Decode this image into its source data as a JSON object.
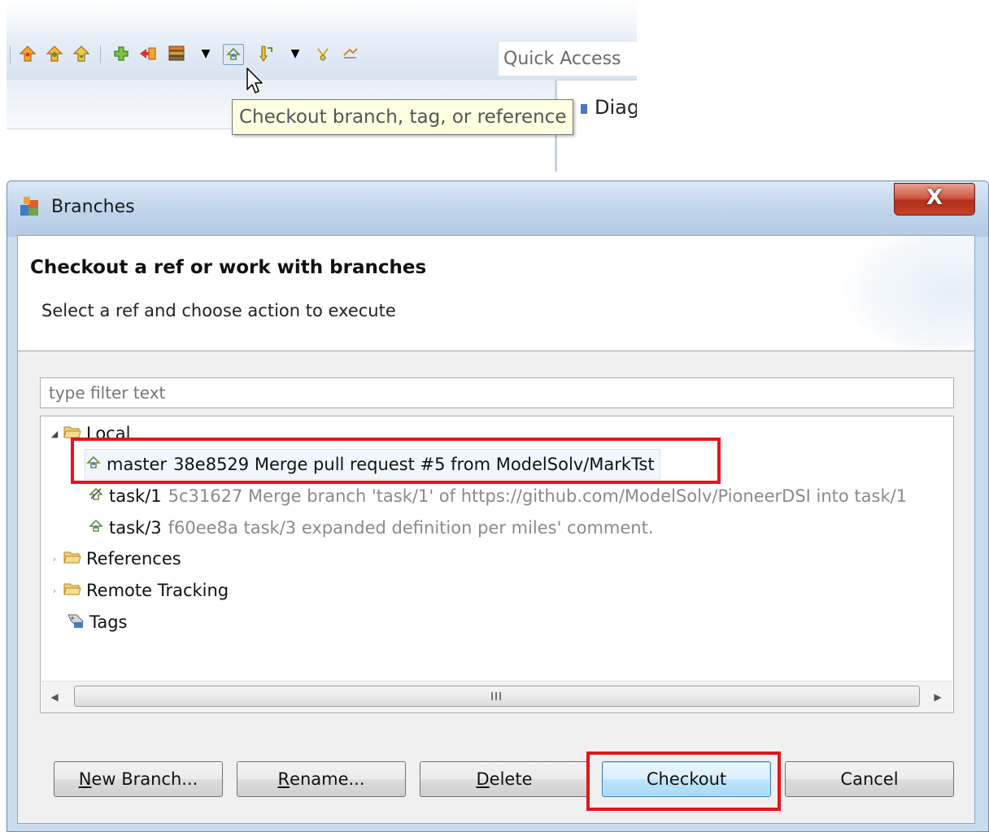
{
  "toolbar": {
    "quick_access": "Quick Access",
    "tooltip": "Checkout branch, tag, or reference",
    "partial_tab": "Diag"
  },
  "dialog": {
    "title": "Branches",
    "close_glyph": "X",
    "header_title": "Checkout a ref or work with branches",
    "header_message": "Select a ref and choose action to execute",
    "filter_placeholder": "type filter text",
    "tree": {
      "local": {
        "label": "Local",
        "branches": [
          {
            "name": "master",
            "detail": "38e8529 Merge pull request #5 from ModelSolv/MarkTst"
          },
          {
            "name": "task/1",
            "detail": "5c31627 Merge branch 'task/1' of https://github.com/ModelSolv/PioneerDSI into task/1"
          },
          {
            "name": "task/3",
            "detail": "f60ee8a task/3 expanded definition per miles' comment."
          }
        ]
      },
      "references": "References",
      "remote_tracking": "Remote Tracking",
      "tags": "Tags"
    },
    "buttons": {
      "new_branch": {
        "mnemonic": "N",
        "rest": "ew Branch..."
      },
      "rename": {
        "mnemonic": "R",
        "rest": "ename..."
      },
      "delete": {
        "mnemonic": "D",
        "rest": "elete"
      },
      "checkout": "Checkout",
      "cancel": "Cancel"
    }
  },
  "colors": {
    "highlight_box": "#e5141b",
    "selection_bg": "#f0f7fe",
    "tooltip_bg": "#ffffe1",
    "title_bar": "#bfd4ea",
    "close_button": "#c7422b"
  },
  "icons": [
    "push-up-icon",
    "fetch-icon",
    "pull-icon",
    "add-icon",
    "merge-icon",
    "stash-icon",
    "dropdown-icon",
    "checkout-branch-icon",
    "commit-icon",
    "history-icon",
    "sync-icon",
    "folder-icon",
    "branch-icon",
    "tag-icon",
    "git-repo-icon",
    "mouse-cursor-icon"
  ]
}
